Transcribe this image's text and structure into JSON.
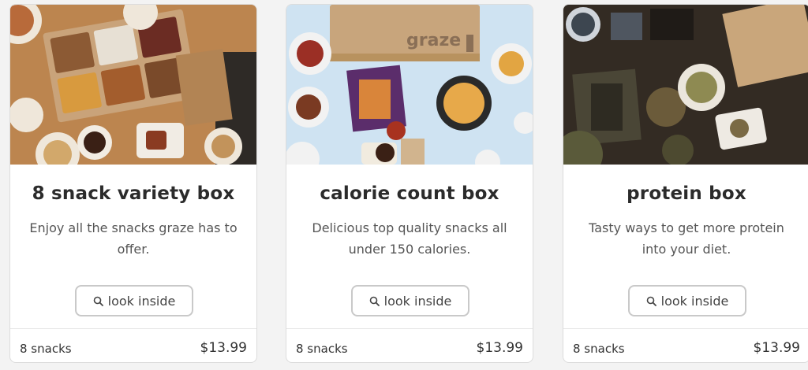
{
  "cards": [
    {
      "title": "8 snack variety box",
      "description": "Enjoy all the snacks graze has to offer.",
      "button_label": "look inside",
      "count": "8 snacks",
      "price": "$13.99",
      "image_alt": "variety box snacks"
    },
    {
      "title": "calorie count box",
      "description": "Delicious top quality snacks all under 150 calories.",
      "button_label": "look inside",
      "count": "8 snacks",
      "price": "$13.99",
      "image_brand": "graze",
      "image_alt": "calorie count snacks"
    },
    {
      "title": "protein box",
      "description": "Tasty ways to get more protein into your diet.",
      "button_label": "look inside",
      "count": "8 snacks",
      "price": "$13.99",
      "image_alt": "protein snacks"
    }
  ],
  "colors": {
    "card_bg": "#ffffff",
    "page_bg": "#f3f3f3",
    "button_border": "#c9c9c9"
  },
  "icons": {
    "search": "search-icon"
  }
}
